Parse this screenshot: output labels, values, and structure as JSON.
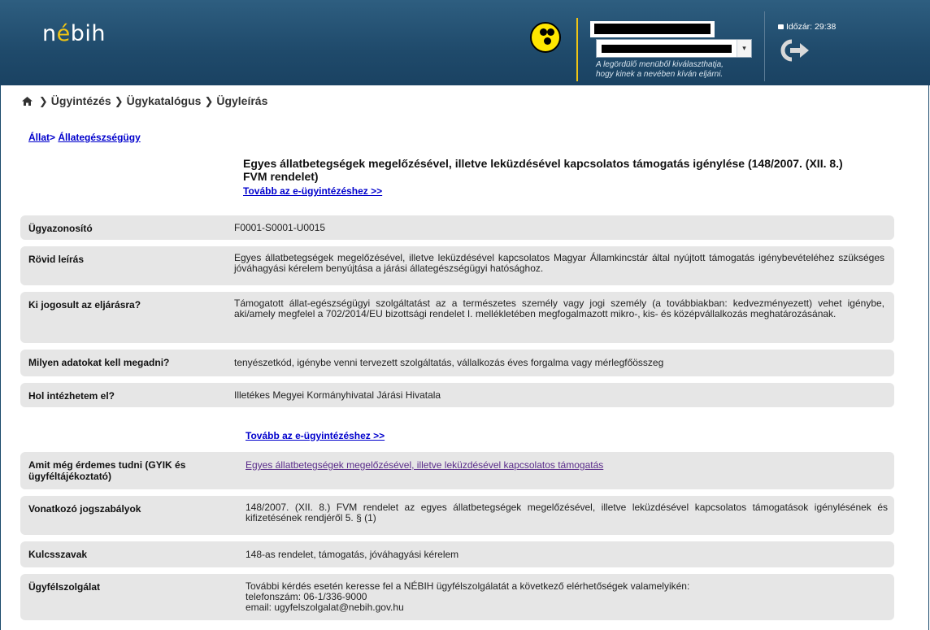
{
  "header": {
    "logo_prefix": "n",
    "logo_accent": "é",
    "logo_suffix": "bih",
    "representation_hint_line1": "A legördülő menüből kiválaszthatja,",
    "representation_hint_line2": "hogy kinek a nevében kíván eljárni.",
    "session_timeout": "Időzár: 29:38",
    "icons": [
      "accessibility-icon",
      "lock-icon",
      "logout-icon",
      "chevron-down-icon"
    ]
  },
  "breadcrumb": {
    "items": [
      "Ügyintézés",
      "Ügykatalógus",
      "Ügyleírás"
    ]
  },
  "category_path": {
    "parent": "Állat",
    "separator": ">",
    "child": "Állategészségügy"
  },
  "case": {
    "title_line1": "Egyes állatbetegségek megelőzésével, illetve leküzdésével kapcsolatos támogatás igénylése (148/2007. (XII. 8.)",
    "title_line2": "FVM rendelet)",
    "continue_link": "Tovább az e-ügyintézéshez >>"
  },
  "rows": [
    {
      "label": "Ügyazonosító",
      "value": "F0001-S0001-U0015"
    },
    {
      "label": "Rövid leírás",
      "value": "Egyes állatbetegségek megelőzésével, illetve leküzdésével kapcsolatos Magyar Államkincstár által nyújtott támogatás igénybevételéhez szükséges jóváhagyási kérelem benyújtása a járási állategészségügyi hatósághoz."
    },
    {
      "label": "Ki jogosult az eljárásra?",
      "value": "Támogatott állat-egészségügyi szolgáltatást az a természetes személy vagy jogi személy (a továbbiakban: kedvezményezett) vehet igénybe, aki/amely megfelel a 702/2014/EU bizottsági rendelet I. mellékletében megfogalmazott mikro-, kis- és középvállalkozás meghatározásának."
    },
    {
      "label": "Milyen adatokat kell megadni?",
      "value": "tenyészetkód, igénybe venni tervezett szolgáltatás, vállalkozás éves forgalma vagy mérlegfőösszeg"
    },
    {
      "label": "Hol intézhetem el?",
      "value": "Illetékes Megyei Kormányhivatal Járási Hivatala"
    }
  ],
  "rows2": [
    {
      "label": "Amit még érdemes tudni (GYIK és ügyféltájékoztató)",
      "link": "Egyes állatbetegségek megelőzésével, illetve leküzdésével kapcsolatos támogatás"
    },
    {
      "label": "Vonatkozó jogszabályok",
      "value": "148/2007. (XII. 8.) FVM rendelet az egyes állatbetegségek megelőzésével, illetve leküzdésével kapcsolatos támogatások igénylésének és kifizetésének rendjéről 5. § (1)"
    },
    {
      "label": "Kulcsszavak",
      "value": "148-as rendelet, támogatás, jóváhagyási kérelem"
    },
    {
      "label": "Ügyfélszolgálat",
      "line1": "További kérdés esetén keresse fel a NÉBIH ügyfélszolgálatát a következő elérhetőségek valamelyikén:",
      "line2": "telefonszám: 06-1/336-9000",
      "line3": "email: ugyfelszolgalat@nebih.gov.hu"
    }
  ],
  "colors": {
    "header_bg": "#1f4a6b",
    "logo_accent": "#f0c514",
    "link": "#0000cc",
    "visited_link": "#5a2c8a",
    "row_bg": "#e6e6e6"
  }
}
